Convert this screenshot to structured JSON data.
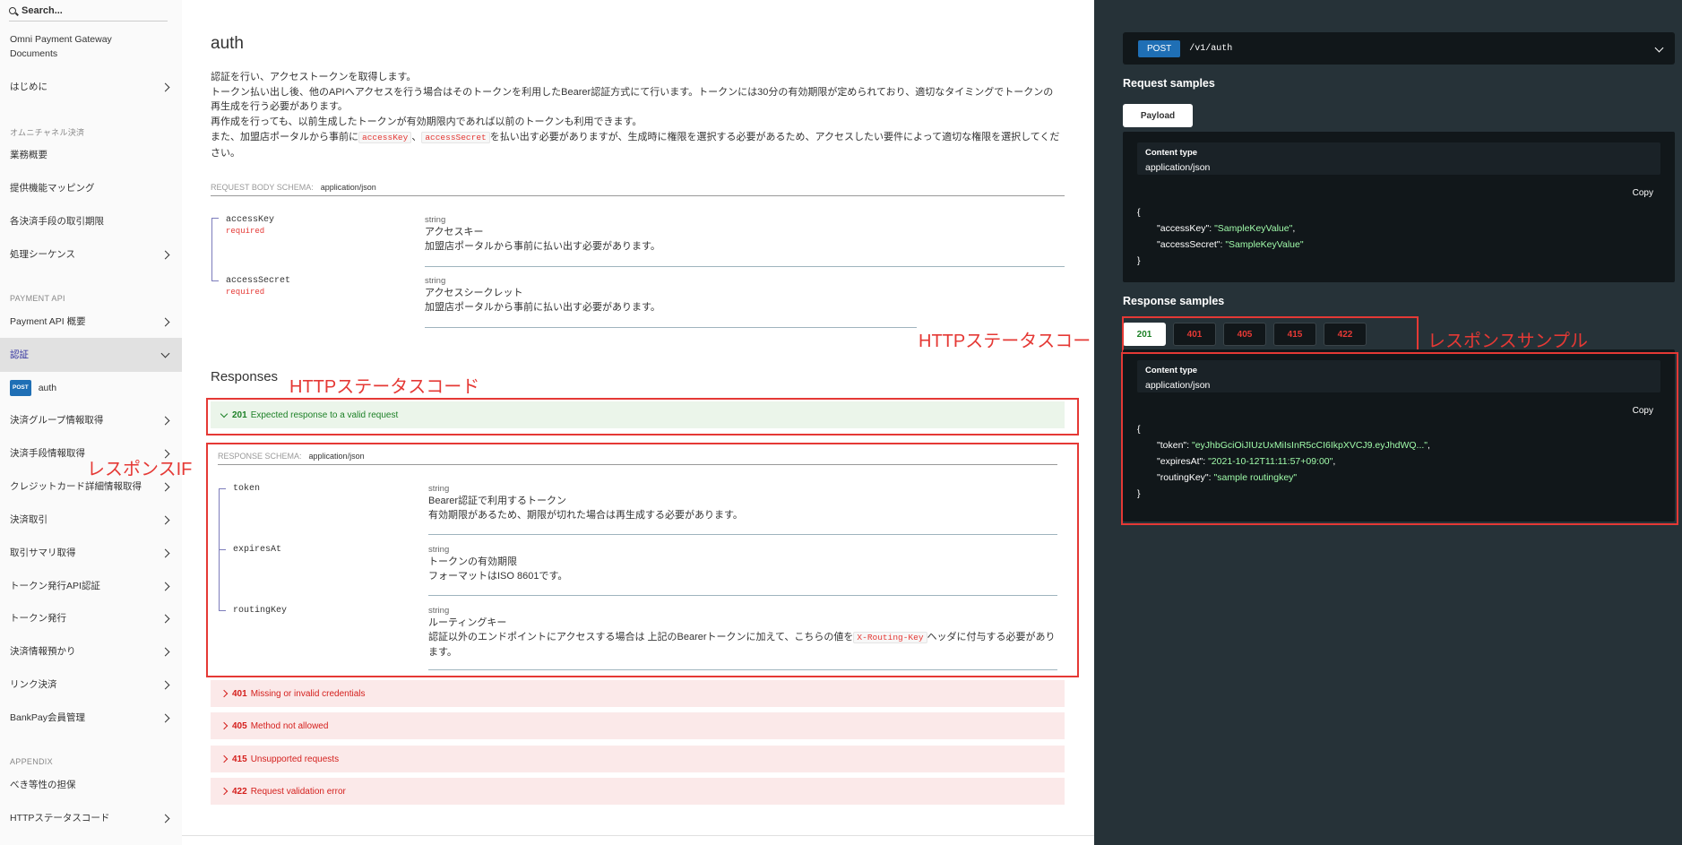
{
  "sidebar": {
    "search_placeholder": "Search...",
    "items": {
      "gateway_docs_line1": "Omni Payment Gateway",
      "gateway_docs_line2": "Documents",
      "intro": "はじめに",
      "group_omni": "オムニチャネル決済",
      "business_overview": "業務概要",
      "feature_mapping": "提供機能マッピング",
      "transaction_deadline": "各決済手段の取引期限",
      "process_sequence": "処理シーケンス",
      "group_payment_api": "PAYMENT API",
      "payment_api_overview": "Payment API 概要",
      "auth_group": "認証",
      "auth_method": "POST",
      "auth_label": "auth",
      "payment_group_info": "決済グループ情報取得",
      "payment_method_info": "決済手段情報取得",
      "credit_card_info": "クレジットカード詳細情報取得",
      "payment_transaction": "決済取引",
      "transaction_summary": "取引サマリ取得",
      "token_api_auth": "トークン発行API認証",
      "token_issue": "トークン発行",
      "payment_info_deposit": "決済情報預かり",
      "link_payment": "リンク決済",
      "bankpay_member": "BankPay会員管理",
      "group_appendix": "APPENDIX",
      "idempotency": "べき等性の担保",
      "http_status": "HTTPステータスコード"
    }
  },
  "main": {
    "title": "auth",
    "description": {
      "line1": "認証を行い、アクセストークンを取得します。",
      "line2": "トークン払い出し後、他のAPIへアクセスを行う場合はそのトークンを利用したBearer認証方式にて行います。トークンには30分の有効期限が定められており、適切なタイミングでトークンの再生成を行う必要があります。",
      "line3": "再作成を行っても、以前生成したトークンが有効期限内であれば以前のトークンも利用できます。",
      "line4_a": "また、加盟店ポータルから事前に",
      "line4_code1": "accessKey",
      "line4_sep": "、",
      "line4_code2": "accessSecret",
      "line4_b": "を払い出す必要がありますが、生成時に権限を選択する必要があるため、アクセスしたい要件によって適切な権限を選択してください。"
    },
    "request_schema": {
      "label": "REQUEST BODY SCHEMA:",
      "content_type": "application/json",
      "fields": [
        {
          "name": "accessKey",
          "required": "required",
          "type": "string",
          "title": "アクセスキー",
          "desc": "加盟店ポータルから事前に払い出す必要があります。"
        },
        {
          "name": "accessSecret",
          "required": "required",
          "type": "string",
          "title": "アクセスシークレット",
          "desc": "加盟店ポータルから事前に払い出す必要があります。"
        }
      ]
    },
    "responses_title": "Responses",
    "response_ok": {
      "code": "201",
      "text": "Expected response to a valid request"
    },
    "response_schema": {
      "label": "RESPONSE SCHEMA:",
      "content_type": "application/json",
      "fields": [
        {
          "name": "token",
          "type": "string",
          "title": "Bearer認証で利用するトークン",
          "desc": "有効期限があるため、期限が切れた場合は再生成する必要があります。"
        },
        {
          "name": "expiresAt",
          "type": "string",
          "title": "トークンの有効期限",
          "desc": "フォーマットはISO 8601です。"
        },
        {
          "name": "routingKey",
          "type": "string",
          "title": "ルーティングキー",
          "desc_a": "認証以外のエンドポイントにアクセスする場合は 上記のBearerトークンに加えて、こちらの値を",
          "desc_code": "X-Routing-Key",
          "desc_b": "ヘッダに付与する必要があります。"
        }
      ]
    },
    "response_errors": [
      {
        "code": "401",
        "text": "Missing or invalid credentials"
      },
      {
        "code": "405",
        "text": "Method not allowed"
      },
      {
        "code": "415",
        "text": "Unsupported requests"
      },
      {
        "code": "422",
        "text": "Request validation error"
      }
    ]
  },
  "annotations": {
    "http_status_code": "HTTPステータスコード",
    "response_if": "レスポンスIF",
    "http_status_code_right": "HTTPステータスコード",
    "response_sample": "レスポンスサンプル"
  },
  "right_panel": {
    "method": "POST",
    "path": "/v1/auth",
    "request_samples_title": "Request samples",
    "payload_tab": "Payload",
    "request_content_type_label": "Content type",
    "request_content_type": "application/json",
    "copy_label": "Copy",
    "request_json": {
      "open": "{",
      "k1": "\"accessKey\"",
      "v1": "\"SampleKeyValue\"",
      "k2": "\"accessSecret\"",
      "v2": "\"SampleKeyValue\"",
      "close": "}"
    },
    "response_samples_title": "Response samples",
    "response_tabs": [
      "201",
      "401",
      "405",
      "415",
      "422"
    ],
    "response_content_type_label": "Content type",
    "response_content_type": "application/json",
    "response_json": {
      "open": "{",
      "k1": "\"token\"",
      "v1": "\"eyJhbGciOiJIUzUxMiIsInR5cCI6IkpXVCJ9.eyJhdWQ...\"",
      "k2": "\"expiresAt\"",
      "v2": "\"2021-10-12T11:11:57+09:00\"",
      "k3": "\"routingKey\"",
      "v3": "\"sample routingkey\"",
      "close": "}"
    }
  },
  "colors": {
    "accent_red": "#e53935",
    "success_green": "#1d8127",
    "post_blue": "#1f6fb5",
    "right_panel_bg": "#263238"
  }
}
